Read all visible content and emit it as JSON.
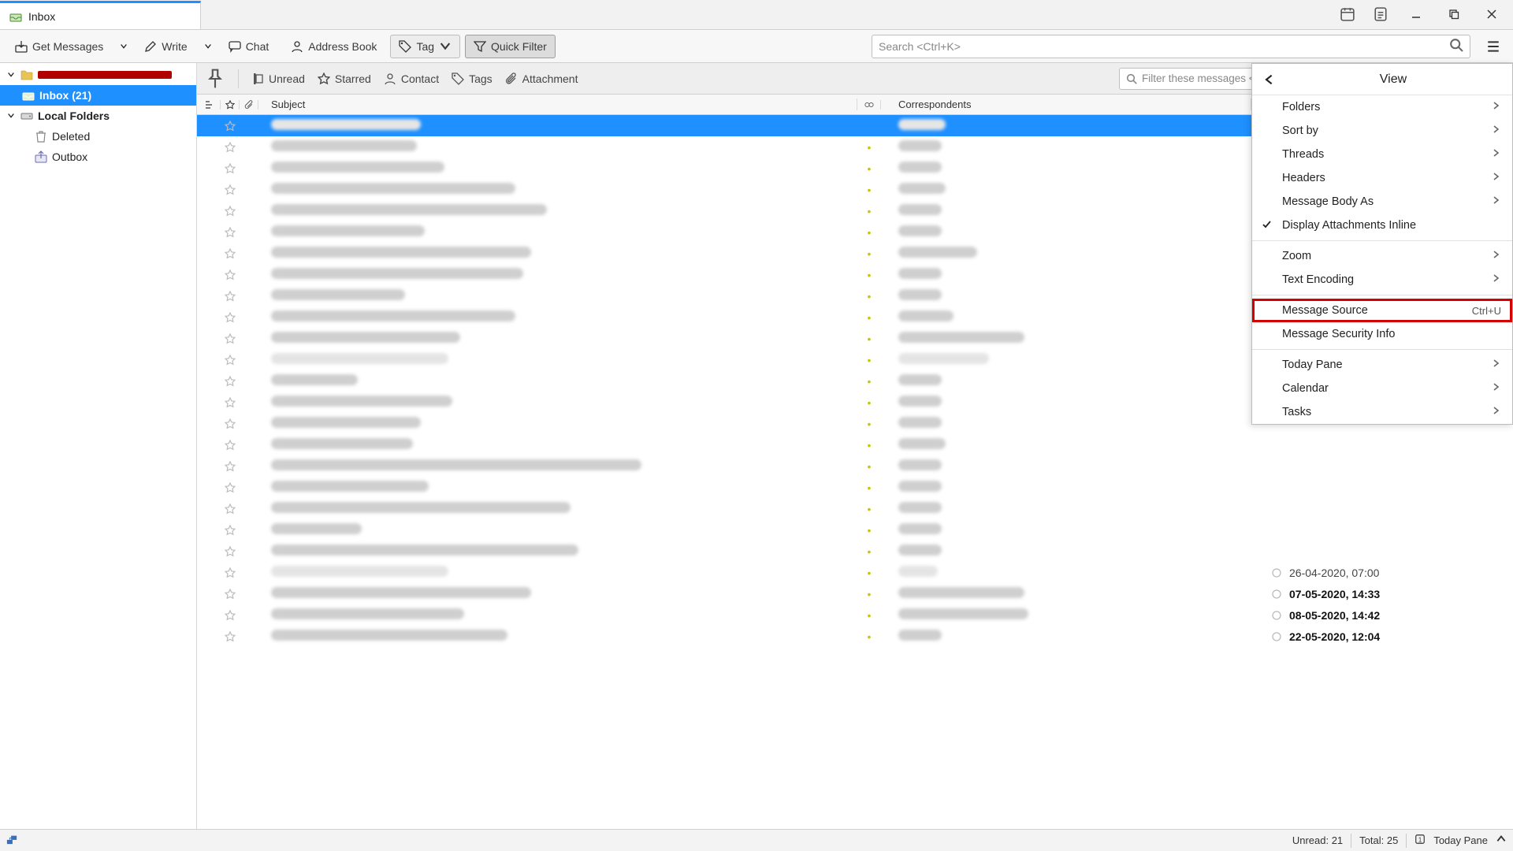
{
  "tab_title": "Inbox",
  "toolbar": {
    "get_messages": "Get Messages",
    "write": "Write",
    "chat": "Chat",
    "address_book": "Address Book",
    "tag": "Tag",
    "quick_filter": "Quick Filter"
  },
  "search": {
    "placeholder": "Search <Ctrl+K>"
  },
  "filterbar": {
    "unread": "Unread",
    "starred": "Starred",
    "contact": "Contact",
    "tags": "Tags",
    "attachment": "Attachment",
    "input_placeholder": "Filter these messages <Ctrl+Shift+K>"
  },
  "columns": {
    "subject": "Subject",
    "correspondents": "Correspondents"
  },
  "sidebar": {
    "inbox_label": "Inbox (21)",
    "local_folders": "Local Folders",
    "deleted": "Deleted",
    "outbox": "Outbox"
  },
  "viewmenu": {
    "title": "View",
    "items": {
      "folders": "Folders",
      "sort_by": "Sort by",
      "threads": "Threads",
      "headers": "Headers",
      "message_body_as": "Message Body As",
      "display_attach": "Display Attachments Inline",
      "zoom": "Zoom",
      "text_encoding": "Text Encoding",
      "message_source": "Message Source",
      "message_source_sc": "Ctrl+U",
      "message_security": "Message Security Info",
      "today_pane": "Today Pane",
      "calendar": "Calendar",
      "tasks": "Tasks"
    }
  },
  "dates": {
    "d0": "26-04-2020, 07:00",
    "d1": "07-05-2020, 14:33",
    "d2": "08-05-2020, 14:42",
    "d3": "22-05-2020, 12:04"
  },
  "status": {
    "unread": "Unread: 21",
    "total": "Total: 25",
    "today_pane": "Today Pane"
  }
}
